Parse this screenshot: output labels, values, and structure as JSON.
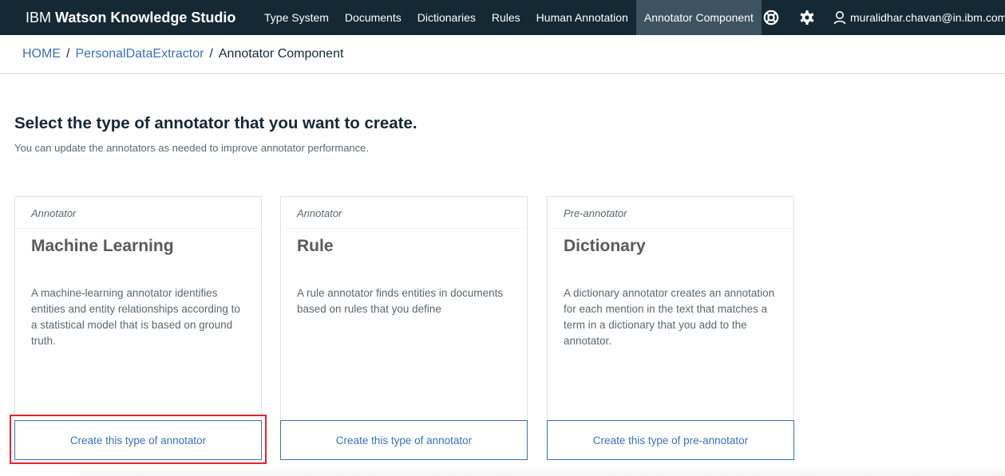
{
  "header": {
    "brand_ibm": "IBM",
    "brand_product": "Watson Knowledge Studio",
    "nav": [
      {
        "label": "Type System",
        "active": false
      },
      {
        "label": "Documents",
        "active": false
      },
      {
        "label": "Dictionaries",
        "active": false
      },
      {
        "label": "Rules",
        "active": false
      },
      {
        "label": "Human Annotation",
        "active": false
      },
      {
        "label": "Annotator Component",
        "active": true
      }
    ],
    "icons": [
      "help-icon",
      "settings-icon",
      "user-icon"
    ],
    "user_email": "muralidhar.chavan@in.ibm.com"
  },
  "breadcrumb": {
    "home": "HOME",
    "project": "PersonalDataExtractor",
    "current": "Annotator Component",
    "separator": "/"
  },
  "main": {
    "headline": "Select the type of annotator that you want to create.",
    "subline": "You can update the annotators as needed to improve annotator performance.",
    "cards": [
      {
        "kind": "Annotator",
        "title": "Machine Learning",
        "description": "A machine-learning annotator identifies entities and entity relationships according to a statistical model that is based on ground truth.",
        "button": "Create this type of annotator",
        "highlighted": true
      },
      {
        "kind": "Annotator",
        "title": "Rule",
        "description": "A rule annotator finds entities in documents based on rules that you define",
        "button": "Create this type of annotator",
        "highlighted": false
      },
      {
        "kind": "Pre-annotator",
        "title": "Dictionary",
        "description": "A dictionary annotator creates an annotation for each mention in the text that matches a term in a dictionary that you add to the annotator.",
        "button": "Create this type of pre-annotator",
        "highlighted": false
      }
    ]
  },
  "colors": {
    "topbar": "#152935",
    "active_tab": "#3d5361",
    "link": "#3d70b2",
    "highlight": "#e0262c"
  }
}
